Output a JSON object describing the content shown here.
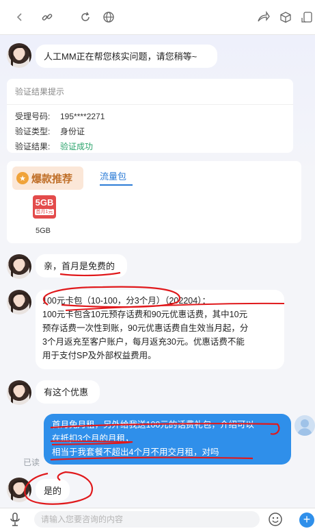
{
  "messages": {
    "agent_notice": "人工MM正在帮您核实问题，请您稍等~",
    "verify": {
      "title": "验证结果提示",
      "rows": [
        {
          "key": "受理号码:",
          "value": "195****2271"
        },
        {
          "key": "验证类型:",
          "value": "身份证"
        },
        {
          "key": "验证结果:",
          "value": "验证成功"
        }
      ]
    },
    "promo": {
      "tag": "爆款推荐",
      "tab": "流量包",
      "package_icon_big": "5GB",
      "package_icon_small": "首月1元",
      "package_label": "5GB"
    },
    "agent_1": "亲，首月是免费的",
    "agent_2_line1": "100元卡包（10-100，分3个月）（202204）：",
    "agent_2_line2": "100元卡包含10元预存话费和90元优惠话费，其中10元",
    "agent_2_line3": "预存话费一次性到账，90元优惠话费自生效当月起，分",
    "agent_2_line4": "3个月返充至客户账户，每月返充30元。优惠话费不能",
    "agent_2_line5": "用于支付SP及外部权益费用。",
    "agent_3": "有这个优惠",
    "user_line1": "首月免月租，另外给我送100元的话费礼包，介绍可以",
    "user_line2": "在抵扣3个月的月租，",
    "user_line3": "相当于我套餐不超出4个月不用交月租，对吗",
    "read_status": "已读",
    "agent_4": "是的"
  },
  "input": {
    "placeholder": "请输入您要咨询的内容"
  },
  "colors": {
    "accent": "#2f8fea",
    "success": "#2aa36b",
    "annotation": "#e0191c"
  }
}
